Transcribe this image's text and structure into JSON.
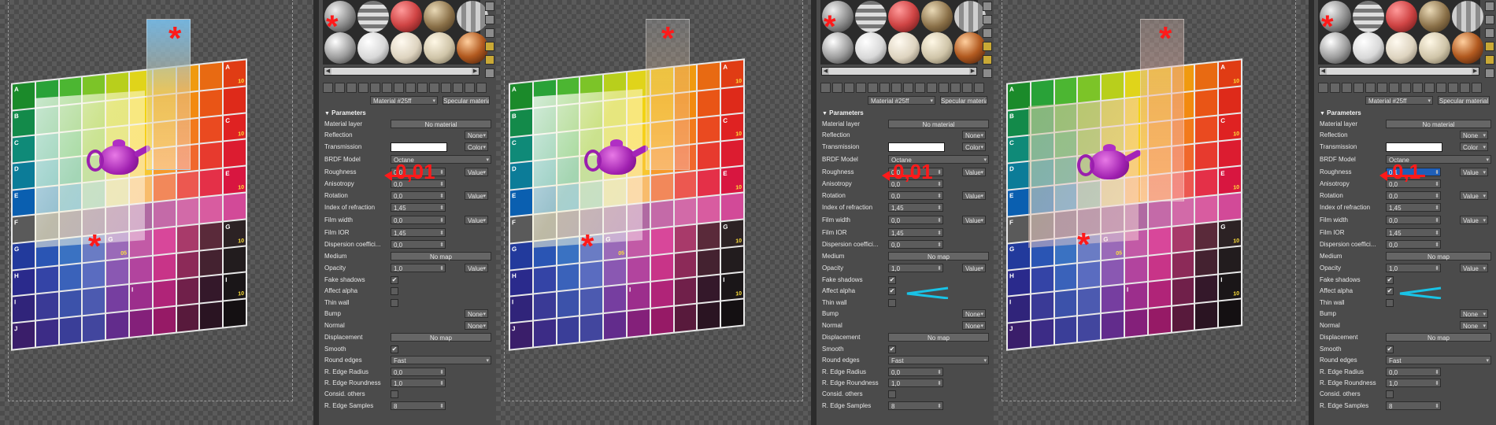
{
  "panels": [
    {
      "material_name": "Material #25ff",
      "material_type": "Specular material",
      "rollout_title": "Parameters",
      "roughness_display": "0,01",
      "annotation_value": "0,01",
      "rows": {
        "material_layer": {
          "label": "Material layer",
          "button": "No material"
        },
        "reflection": {
          "label": "Reflection",
          "drop": "None"
        },
        "transmission": {
          "label": "Transmission",
          "drop": "Color"
        },
        "brdf_model": {
          "label": "BRDF Model",
          "drop": "Octane"
        },
        "roughness": {
          "label": "Roughness",
          "value": "0,01",
          "drop": "Value"
        },
        "anisotropy": {
          "label": "Anisotropy",
          "value": "0,0"
        },
        "rotation": {
          "label": "Rotation",
          "value": "0,0",
          "drop": "Value"
        },
        "ior": {
          "label": "Index of refraction",
          "value": "1,45"
        },
        "film_width": {
          "label": "Film width",
          "value": "0,0",
          "drop": "Value"
        },
        "film_ior": {
          "label": "Film IOR",
          "value": "1,45"
        },
        "dispersion": {
          "label": "Dispersion coeffici...",
          "value": "0,0"
        },
        "medium": {
          "label": "Medium",
          "button": "No map"
        },
        "opacity": {
          "label": "Opacity",
          "value": "1,0",
          "drop": "Value"
        },
        "fake_shadows": {
          "label": "Fake shadows",
          "checked": "✔"
        },
        "affect_alpha": {
          "label": "Affect alpha",
          "checked": ""
        },
        "thin_wall": {
          "label": "Thin wall",
          "checked": ""
        },
        "bump": {
          "label": "Bump",
          "drop": "None"
        },
        "normal": {
          "label": "Normal",
          "drop": "None"
        },
        "displacement": {
          "label": "Displacement",
          "button": "No map"
        },
        "smooth": {
          "label": "Smooth",
          "checked": "✔"
        },
        "round_edges": {
          "label": "Round edges",
          "drop": "Fast"
        },
        "edge_radius": {
          "label": "R. Edge Radius",
          "value": "0,0"
        },
        "edge_roundness": {
          "label": "R. Edge Roundness",
          "value": "1,0"
        },
        "consid_others": {
          "label": "Consid. others",
          "checked": ""
        },
        "edge_samples": {
          "label": "R. Edge Samples",
          "value": "8"
        }
      }
    },
    {
      "material_name": "Material #25ff",
      "material_type": "Specular material",
      "rollout_title": "Parameters",
      "annotation_value": "0,01",
      "rows": {
        "material_layer": {
          "label": "Material layer",
          "button": "No material"
        },
        "reflection": {
          "label": "Reflection",
          "drop": "None"
        },
        "transmission": {
          "label": "Transmission",
          "drop": "Color"
        },
        "brdf_model": {
          "label": "BRDF Model",
          "drop": "Octane"
        },
        "roughness": {
          "label": "Roughness",
          "value": "0,01",
          "drop": "Value"
        },
        "anisotropy": {
          "label": "Anisotropy",
          "value": "0,0"
        },
        "rotation": {
          "label": "Rotation",
          "value": "0,0",
          "drop": "Value"
        },
        "ior": {
          "label": "Index of refraction",
          "value": "1,45"
        },
        "film_width": {
          "label": "Film width",
          "value": "0,0",
          "drop": "Value"
        },
        "film_ior": {
          "label": "Film IOR",
          "value": "1,45"
        },
        "dispersion": {
          "label": "Dispersion coeffici...",
          "value": "0,0"
        },
        "medium": {
          "label": "Medium",
          "button": "No map"
        },
        "opacity": {
          "label": "Opacity",
          "value": "1,0",
          "drop": "Value"
        },
        "fake_shadows": {
          "label": "Fake shadows",
          "checked": "✔"
        },
        "affect_alpha": {
          "label": "Affect alpha",
          "checked": "✔"
        },
        "thin_wall": {
          "label": "Thin wall",
          "checked": ""
        },
        "bump": {
          "label": "Bump",
          "drop": "None"
        },
        "normal": {
          "label": "Normal",
          "drop": "None"
        },
        "displacement": {
          "label": "Displacement",
          "button": "No map"
        },
        "smooth": {
          "label": "Smooth",
          "checked": "✔"
        },
        "round_edges": {
          "label": "Round edges",
          "drop": "Fast"
        },
        "edge_radius": {
          "label": "R. Edge Radius",
          "value": "0,0"
        },
        "edge_roundness": {
          "label": "R. Edge Roundness",
          "value": "1,0"
        },
        "consid_others": {
          "label": "Consid. others",
          "checked": ""
        },
        "edge_samples": {
          "label": "R. Edge Samples",
          "value": "8"
        }
      }
    },
    {
      "material_name": "Material #25ff",
      "material_type": "Specular material",
      "rollout_title": "Parameters",
      "annotation_value": "0,1",
      "rows": {
        "material_layer": {
          "label": "Material layer",
          "button": "No material"
        },
        "reflection": {
          "label": "Reflection",
          "drop": "None"
        },
        "transmission": {
          "label": "Transmission",
          "drop": "Color"
        },
        "brdf_model": {
          "label": "BRDF Model",
          "drop": "Octane"
        },
        "roughness": {
          "label": "Roughness",
          "value": "0,1",
          "drop": "Value"
        },
        "anisotropy": {
          "label": "Anisotropy",
          "value": "0,0"
        },
        "rotation": {
          "label": "Rotation",
          "value": "0,0",
          "drop": "Value"
        },
        "ior": {
          "label": "Index of refraction",
          "value": "1,45"
        },
        "film_width": {
          "label": "Film width",
          "value": "0,0",
          "drop": "Value"
        },
        "film_ior": {
          "label": "Film IOR",
          "value": "1,45"
        },
        "dispersion": {
          "label": "Dispersion coeffici...",
          "value": "0,0"
        },
        "medium": {
          "label": "Medium",
          "button": "No map"
        },
        "opacity": {
          "label": "Opacity",
          "value": "1,0",
          "drop": "Value"
        },
        "fake_shadows": {
          "label": "Fake shadows",
          "checked": "✔"
        },
        "affect_alpha": {
          "label": "Affect alpha",
          "checked": "✔"
        },
        "thin_wall": {
          "label": "Thin wall",
          "checked": ""
        },
        "bump": {
          "label": "Bump",
          "drop": "None"
        },
        "normal": {
          "label": "Normal",
          "drop": "None"
        },
        "displacement": {
          "label": "Displacement",
          "button": "No map"
        },
        "smooth": {
          "label": "Smooth",
          "checked": "✔"
        },
        "round_edges": {
          "label": "Round edges",
          "drop": "Fast"
        },
        "edge_radius": {
          "label": "R. Edge Radius",
          "value": "0,0"
        },
        "edge_roundness": {
          "label": "R. Edge Roundness",
          "value": "1,0"
        },
        "consid_others": {
          "label": "Consid. others",
          "checked": ""
        },
        "edge_samples": {
          "label": "R. Edge Samples",
          "value": "8"
        }
      }
    }
  ],
  "viewports": {
    "star_glyph": "*",
    "chart_row_letters": [
      "A",
      "B",
      "C",
      "D",
      "E",
      "F",
      "G",
      "H",
      "I",
      "J"
    ],
    "chart_column_codes": [
      "01",
      "02",
      "03",
      "04",
      "05",
      "06",
      "07",
      "08",
      "09",
      "10"
    ]
  },
  "colors": {
    "annotation_red": "#ff1a1a",
    "annotation_cyan": "#19c3e6",
    "panel_bg": "#4b4b4b",
    "selection_blue": "#1f5fb8"
  }
}
